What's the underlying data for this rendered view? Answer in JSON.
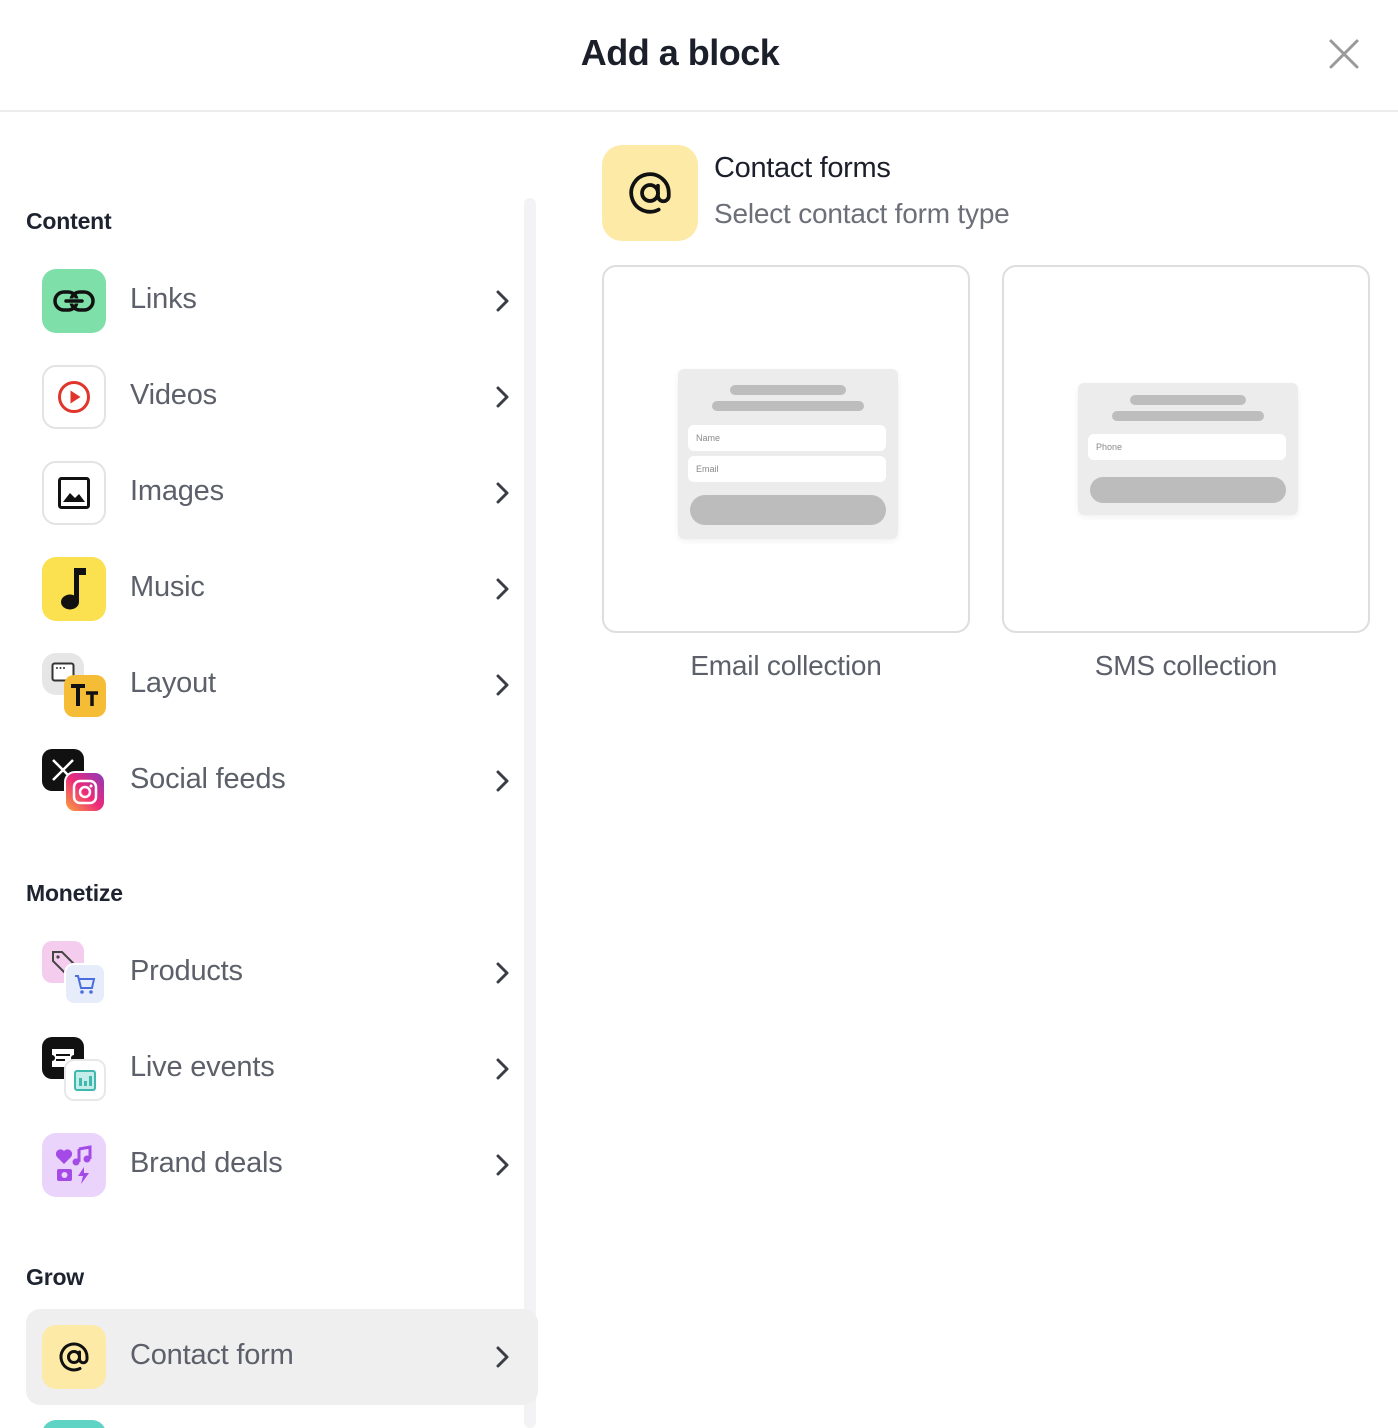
{
  "header": {
    "title": "Add a block"
  },
  "sidebar": {
    "sections": [
      {
        "label": "Content"
      },
      {
        "label": "Monetize"
      },
      {
        "label": "Grow"
      }
    ],
    "items": [
      {
        "label": "Links"
      },
      {
        "label": "Videos"
      },
      {
        "label": "Images"
      },
      {
        "label": "Music"
      },
      {
        "label": "Layout"
      },
      {
        "label": "Social feeds"
      },
      {
        "label": "Products"
      },
      {
        "label": "Live events"
      },
      {
        "label": "Brand deals"
      },
      {
        "label": "Contact form"
      }
    ]
  },
  "panel": {
    "title": "Contact forms",
    "subtitle": "Select contact form type",
    "options": [
      {
        "label": "Email collection",
        "fields": [
          "Name",
          "Email"
        ]
      },
      {
        "label": "SMS collection",
        "fields": [
          "Phone"
        ]
      }
    ]
  },
  "colors": {
    "links_bg": "#7ee0a8",
    "music_bg": "#fbe04f",
    "contact_bg": "#fdeaa7",
    "brand_bg": "#ead4fb",
    "active_row": "#efefef"
  }
}
